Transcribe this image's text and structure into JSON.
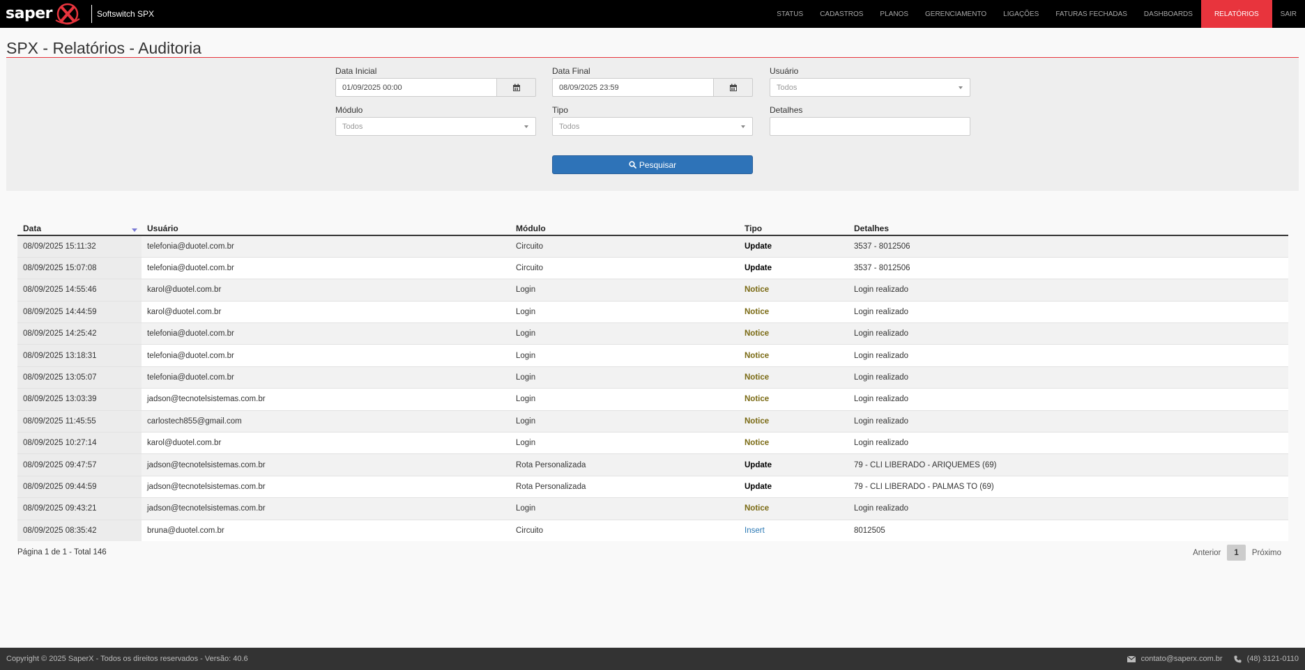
{
  "brand": {
    "logo_text": "saper",
    "subtitle": "Softswitch SPX",
    "accent": "#e8343d"
  },
  "nav": [
    {
      "label": "STATUS",
      "name": "nav-status",
      "active": false
    },
    {
      "label": "CADASTROS",
      "name": "nav-cadastros",
      "active": false
    },
    {
      "label": "PLANOS",
      "name": "nav-planos",
      "active": false
    },
    {
      "label": "GERENCIAMENTO",
      "name": "nav-gerenciamento",
      "active": false
    },
    {
      "label": "LIGAÇÕES",
      "name": "nav-ligacoes",
      "active": false
    },
    {
      "label": "FATURAS FECHADAS",
      "name": "nav-faturas-fechadas",
      "active": false
    },
    {
      "label": "DASHBOARDS",
      "name": "nav-dashboards",
      "active": false
    },
    {
      "label": "RELATÓRIOS",
      "name": "nav-relatorios",
      "active": true
    },
    {
      "label": "SAIR",
      "name": "nav-sair",
      "active": false
    }
  ],
  "page": {
    "title": "SPX - Relatórios - Auditoria"
  },
  "filters": {
    "data_inicial": {
      "label": "Data Inicial",
      "value": "01/09/2025 00:00"
    },
    "data_final": {
      "label": "Data Final",
      "value": "08/09/2025 23:59"
    },
    "usuario": {
      "label": "Usuário",
      "value": "Todos"
    },
    "modulo": {
      "label": "Módulo",
      "value": "Todos"
    },
    "tipo": {
      "label": "Tipo",
      "value": "Todos"
    },
    "detalhes": {
      "label": "Detalhes",
      "value": ""
    },
    "search_label": "Pesquisar"
  },
  "table": {
    "headers": {
      "data": "Data",
      "usuario": "Usuário",
      "modulo": "Módulo",
      "tipo": "Tipo",
      "detalhes": "Detalhes"
    },
    "rows": [
      {
        "data": "08/09/2025 15:11:32",
        "usuario": "telefonia@duotel.com.br",
        "modulo": "Circuito",
        "tipo": "Update",
        "detalhes": "3537 - 8012506"
      },
      {
        "data": "08/09/2025 15:07:08",
        "usuario": "telefonia@duotel.com.br",
        "modulo": "Circuito",
        "tipo": "Update",
        "detalhes": "3537 - 8012506"
      },
      {
        "data": "08/09/2025 14:55:46",
        "usuario": "karol@duotel.com.br",
        "modulo": "Login",
        "tipo": "Notice",
        "detalhes": "Login realizado"
      },
      {
        "data": "08/09/2025 14:44:59",
        "usuario": "karol@duotel.com.br",
        "modulo": "Login",
        "tipo": "Notice",
        "detalhes": "Login realizado"
      },
      {
        "data": "08/09/2025 14:25:42",
        "usuario": "telefonia@duotel.com.br",
        "modulo": "Login",
        "tipo": "Notice",
        "detalhes": "Login realizado"
      },
      {
        "data": "08/09/2025 13:18:31",
        "usuario": "telefonia@duotel.com.br",
        "modulo": "Login",
        "tipo": "Notice",
        "detalhes": "Login realizado"
      },
      {
        "data": "08/09/2025 13:05:07",
        "usuario": "telefonia@duotel.com.br",
        "modulo": "Login",
        "tipo": "Notice",
        "detalhes": "Login realizado"
      },
      {
        "data": "08/09/2025 13:03:39",
        "usuario": "jadson@tecnotelsistemas.com.br",
        "modulo": "Login",
        "tipo": "Notice",
        "detalhes": "Login realizado"
      },
      {
        "data": "08/09/2025 11:45:55",
        "usuario": "carlostech855@gmail.com",
        "modulo": "Login",
        "tipo": "Notice",
        "detalhes": "Login realizado"
      },
      {
        "data": "08/09/2025 10:27:14",
        "usuario": "karol@duotel.com.br",
        "modulo": "Login",
        "tipo": "Notice",
        "detalhes": "Login realizado"
      },
      {
        "data": "08/09/2025 09:47:57",
        "usuario": "jadson@tecnotelsistemas.com.br",
        "modulo": "Rota Personalizada",
        "tipo": "Update",
        "detalhes": "79 - CLI LIBERADO - ARIQUEMES (69)"
      },
      {
        "data": "08/09/2025 09:44:59",
        "usuario": "jadson@tecnotelsistemas.com.br",
        "modulo": "Rota Personalizada",
        "tipo": "Update",
        "detalhes": "79 - CLI LIBERADO - PALMAS TO (69)"
      },
      {
        "data": "08/09/2025 09:43:21",
        "usuario": "jadson@tecnotelsistemas.com.br",
        "modulo": "Login",
        "tipo": "Notice",
        "detalhes": "Login realizado"
      },
      {
        "data": "08/09/2025 08:35:42",
        "usuario": "bruna@duotel.com.br",
        "modulo": "Circuito",
        "tipo": "Insert",
        "detalhes": "8012505"
      }
    ]
  },
  "pagination": {
    "info": "Página 1 de 1 - Total 146",
    "prev": "Anterior",
    "current": "1",
    "next": "Próximo"
  },
  "footer": {
    "copyright": "Copyright © 2025 SaperX - Todos os direitos reservados - Versão: 40.6",
    "email": "contato@saperx.com.br",
    "phone": "(48) 3121-0110"
  }
}
